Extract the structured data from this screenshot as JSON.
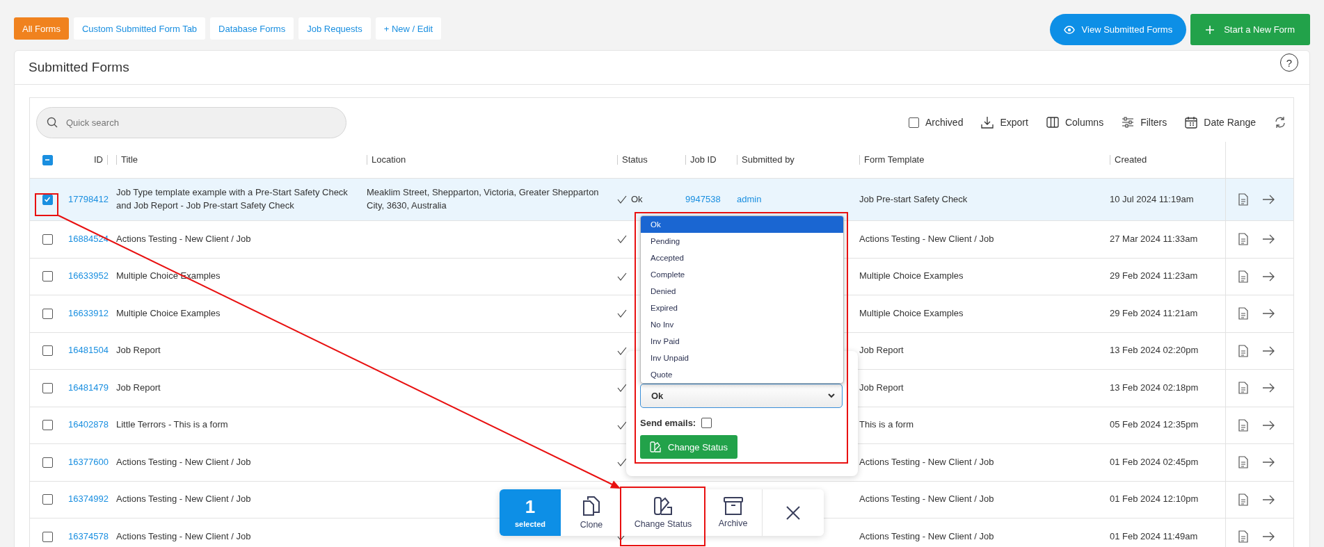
{
  "tabs": [
    {
      "label": "All Forms",
      "selected": true
    },
    {
      "label": "Custom Submitted Form Tab",
      "selected": false
    },
    {
      "label": "Database Forms",
      "selected": false
    },
    {
      "label": "Job Requests",
      "selected": false
    },
    {
      "label": "+ New / Edit",
      "selected": false
    }
  ],
  "view_button": "View Submitted Forms",
  "start_button": "Start a New Form",
  "card_title": "Submitted Forms",
  "help": "?",
  "search": {
    "placeholder": "Quick search"
  },
  "tools": {
    "archived": {
      "label": "Archived",
      "checked": false
    },
    "export": "Export",
    "columns": "Columns",
    "filters": "Filters",
    "date_range": "Date Range"
  },
  "select_all": {
    "partial": true
  },
  "columns": [
    "ID",
    "Title",
    "Location",
    "Status",
    "Job ID",
    "Submitted by",
    "Form Template",
    "Created"
  ],
  "rows": [
    {
      "id": "17798412",
      "title": "Job Type template example with a Pre-Start Safety Check and Job Report - Job Pre-start Safety Check",
      "location": "Meaklim Street, Shepparton, Victoria, Greater Shepparton City, 3630, Australia",
      "status": "Ok",
      "job_id": "9947538",
      "submitted_by": "admin",
      "form_template": "Job Pre-start Safety Check",
      "created": "10 Jul 2024 11:19am",
      "selected": true,
      "status_check": true
    },
    {
      "id": "16884524",
      "title": "Actions Testing - New Client / Job",
      "form_template": "Actions Testing - New Client / Job",
      "created": "27 Mar 2024 11:33am",
      "selected": false,
      "status_check": true
    },
    {
      "id": "16633952",
      "title": "Multiple Choice Examples",
      "form_template": "Multiple Choice Examples",
      "created": "29 Feb 2024 11:23am",
      "selected": false,
      "status_check": true
    },
    {
      "id": "16633912",
      "title": "Multiple Choice Examples",
      "form_template": "Multiple Choice Examples",
      "created": "29 Feb 2024 11:21am",
      "selected": false,
      "status_check": true
    },
    {
      "id": "16481504",
      "title": "Job Report",
      "form_template": "Job Report",
      "created": "13 Feb 2024 02:20pm",
      "selected": false,
      "status_check": true
    },
    {
      "id": "16481479",
      "title": "Job Report",
      "form_template": "Job Report",
      "created": "13 Feb 2024 02:18pm",
      "selected": false,
      "status_check": true
    },
    {
      "id": "16402878",
      "title": "Little Terrors - This is a form",
      "form_template": "This is a form",
      "created": "05 Feb 2024 12:35pm",
      "selected": false,
      "status_check": true
    },
    {
      "id": "16377600",
      "title": "Actions Testing - New Client / Job",
      "form_template": "Actions Testing - New Client / Job",
      "created": "01 Feb 2024 02:45pm",
      "selected": false,
      "status_check": true
    },
    {
      "id": "16374992",
      "title": "Actions Testing - New Client / Job",
      "form_template": "Actions Testing - New Client / Job",
      "created": "01 Feb 2024 12:10pm",
      "selected": false
    },
    {
      "id": "16374578",
      "title": "Actions Testing - New Client / Job",
      "form_template": "Actions Testing - New Client / Job",
      "created": "01 Feb 2024 11:49am",
      "selected": false,
      "status_check": true
    }
  ],
  "status_popup": {
    "options": [
      {
        "label": "Ok",
        "selected": true
      },
      {
        "label": "Pending",
        "selected": false
      },
      {
        "label": "Accepted",
        "selected": false
      },
      {
        "label": "Complete",
        "selected": false
      },
      {
        "label": "Denied",
        "selected": false
      },
      {
        "label": "Expired",
        "selected": false
      },
      {
        "label": "No Inv",
        "selected": false
      },
      {
        "label": "Inv Paid",
        "selected": false
      },
      {
        "label": "Inv Unpaid",
        "selected": false
      },
      {
        "label": "Quote",
        "selected": false
      }
    ],
    "value": "Ok",
    "send_emails": {
      "label": "Send emails:",
      "checked": false
    },
    "button": "Change Status"
  },
  "bulk_bar": {
    "count": "1",
    "count_label": "selected",
    "actions": [
      {
        "kind": "clone",
        "label": "Clone"
      },
      {
        "kind": "status",
        "label": "Change Status"
      },
      {
        "kind": "archive",
        "label": "Archive"
      }
    ]
  }
}
